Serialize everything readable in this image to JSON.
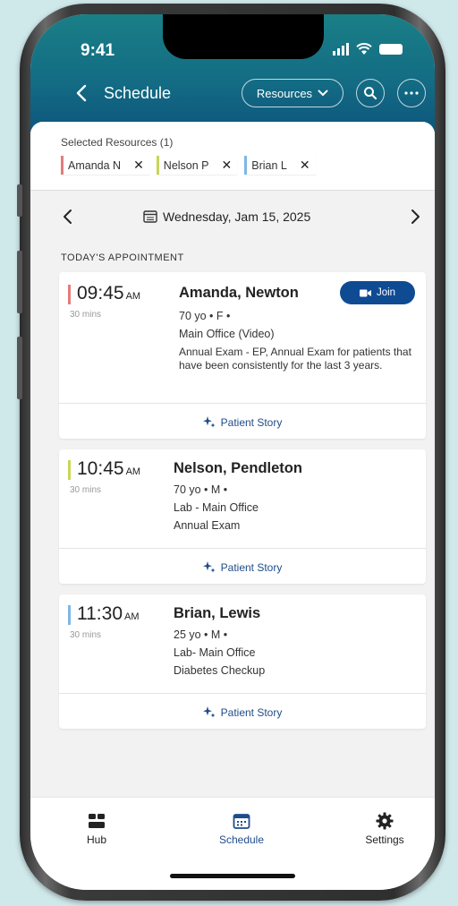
{
  "status_bar": {
    "time": "9:41"
  },
  "header": {
    "title": "Schedule",
    "resources_label": "Resources"
  },
  "selected_resources": {
    "label": "Selected Resources (1)",
    "chips": [
      {
        "name": "Amanda N",
        "color": "#e47b7b"
      },
      {
        "name": "Nelson P",
        "color": "#c7d65a"
      },
      {
        "name": "Brian L",
        "color": "#7eb7e6"
      }
    ]
  },
  "date_nav": {
    "date": "Wednesday, Jam 15, 2025"
  },
  "section_label": "TODAY'S APPOINTMENT",
  "appointments": [
    {
      "time": "09:45",
      "ampm": "AM",
      "duration": "30 mins",
      "name": "Amanda, Newton",
      "demographics": "70 yo  •  F  •",
      "location": "Main Office (Video)",
      "reason": "Annual Exam - EP, Annual Exam for patients that have been consistently for the last 3 years.",
      "join_label": "Join",
      "story_label": "Patient Story",
      "color": "#e47b7b"
    },
    {
      "time": "10:45",
      "ampm": "AM",
      "duration": "30 mins",
      "name": "Nelson, Pendleton",
      "demographics": "70 yo  •  M  •",
      "location": "Lab - Main Office",
      "reason": "Annual Exam",
      "story_label": "Patient Story",
      "color": "#c7d65a"
    },
    {
      "time": "11:30",
      "ampm": "AM",
      "duration": "30 mins",
      "name": "Brian, Lewis",
      "demographics": "25 yo  •  M  •",
      "location": "Lab- Main Office",
      "reason": "Diabetes Checkup",
      "story_label": "Patient Story",
      "color": "#7eb7e6"
    }
  ],
  "tabbar": {
    "items": [
      {
        "label": "Hub",
        "icon": "hub-icon"
      },
      {
        "label": "Schedule",
        "icon": "calendar-icon",
        "active": true
      },
      {
        "label": "Settings",
        "icon": "gear-icon"
      }
    ],
    "active_color": "#1f4c8a"
  }
}
